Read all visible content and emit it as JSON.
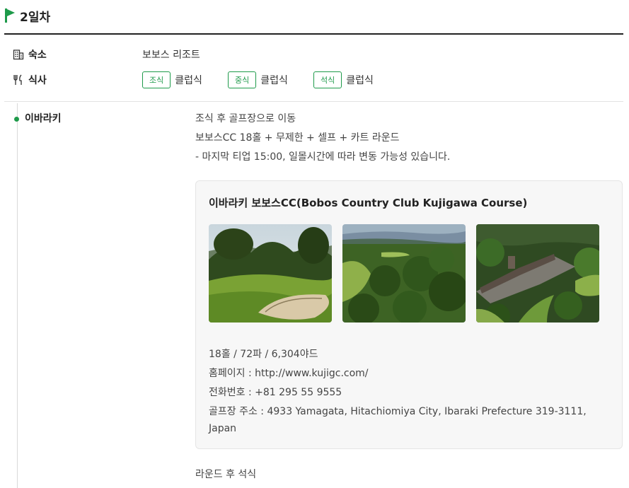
{
  "day": {
    "title": "2일차"
  },
  "accommodation": {
    "label": "숙소",
    "value": "보보스 리조트"
  },
  "meals": {
    "label": "식사",
    "items": [
      {
        "badge": "조식",
        "text": "클럽식"
      },
      {
        "badge": "중식",
        "text": "클럽식"
      },
      {
        "badge": "석식",
        "text": "클럽식"
      }
    ]
  },
  "schedule": {
    "location": "이바라키",
    "lines": [
      "조식 후 골프장으로 이동",
      "보보스CC 18홀 + 무제한 + 셀프 + 카트 라운드",
      "- 마지막 티업 15:00, 일몰시간에 따라 변동 가능성 있습니다."
    ],
    "course": {
      "title": "이바라키 보보스CC(Bobos Country Club Kujigawa Course)",
      "photos": [
        "golf-bunker-photo",
        "forest-fairway-photo",
        "clubhouse-aerial-photo"
      ],
      "lines": [
        "18홀 / 72파 / 6,304야드",
        "홈페이지 : http://www.kujigc.com/",
        "전화번호 : +81 295 55 9555",
        "골프장 주소 : 4933 Yamagata, Hitachiomiya City, Ibaraki Prefecture 319-3111,",
        "Japan"
      ]
    },
    "after": "라운드 후 석식"
  },
  "colors": {
    "accent": "#1e9a4a",
    "text": "#222222",
    "muted": "#444444"
  },
  "icons": {
    "day": "flag-icon",
    "accommodation": "building-icon",
    "meals": "fork-knife-icon"
  }
}
